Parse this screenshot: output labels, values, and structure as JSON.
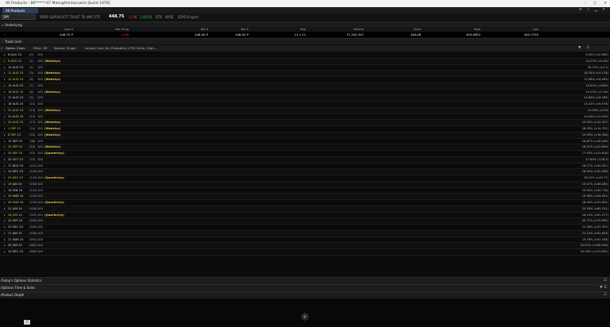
{
  "window": {
    "title": "All Products - 86******47 Main@thinkorswim [build 1978]",
    "controls": [
      "–",
      "□",
      "✕"
    ]
  },
  "tab": {
    "label": "All Products"
  },
  "toolbar_icons": [
    "gear-icon",
    "link-icon",
    "minimize-icon",
    "close-icon"
  ],
  "symbol": {
    "ticker": "SPY",
    "description": "SPDR S&P500 ETF TRUST TR UNIT ETF",
    "last": "448.75",
    "change": "-1.96",
    "bid_flag": "1.001%",
    "etb": "ETB",
    "nyse": "NYSE",
    "engine": "EDYO Engine"
  },
  "underlying": {
    "section_label": "Underlying",
    "headers": [
      "Last X",
      "Net Chng",
      "Bid X",
      "Ask X",
      "Size",
      "Volume",
      "Open",
      "High",
      "Low"
    ],
    "values": [
      "448.75 P",
      "-1.96",
      "448.00 P",
      "448.00 P",
      "11 x 11",
      "71,342,347",
      "448.08",
      "450.6952",
      "445.2705"
    ]
  },
  "trade_grid": {
    "label": "Trade Grid"
  },
  "option_chain": {
    "label": "Option Chain",
    "filter": "Filter: Off",
    "spread": "Spread: Single",
    "layout": "Layout: Impl Vol, Probability OTM, Delta, High,..."
  },
  "expirations": [
    {
      "date": "8 AUG 23",
      "dte": "(0)",
      "mult": "100",
      "tag": "",
      "iv": "5.55% (±0.695)"
    },
    {
      "date": "9 AUG 23",
      "dte": "(1)",
      "mult": "100",
      "tag": "(Weeklys)",
      "iv": "14.77% (±2.54)"
    },
    {
      "date": "10 AUG 23",
      "dte": "(2)",
      "mult": "100",
      "tag": "",
      "iv": "16.72% (±4.3)"
    },
    {
      "date": "11 AUG 23",
      "dte": "(3)",
      "mult": "100",
      "tag": "(Weeklys)",
      "iv": "16.33% (±5.178)"
    },
    {
      "date": "14 AUG 23",
      "dte": "(6)",
      "mult": "100",
      "tag": "(Weeklys)",
      "iv": "13.36% (±6.063)"
    },
    {
      "date": "15 AUG 23",
      "dte": "(7)",
      "mult": "100",
      "tag": "",
      "iv": "13.91% (±6.65)"
    },
    {
      "date": "16 AUG 23",
      "dte": "(8)",
      "mult": "100",
      "tag": "(Weeklys)",
      "iv": "14.23% (±7.49)"
    },
    {
      "date": "17 AUG 23",
      "dte": "(9)",
      "mult": "100",
      "tag": "",
      "iv": "14.64% (±8.185)"
    },
    {
      "date": "18 AUG 23",
      "dte": "(10)",
      "mult": "100",
      "tag": "",
      "iv": "15.43% (±8.978)"
    },
    {
      "date": "21 AUG 23",
      "dte": "(13)",
      "mult": "100",
      "tag": "(Weeklys)",
      "iv": "14.28% (±9.6)"
    },
    {
      "date": "22 AUG 23",
      "dte": "(14)",
      "mult": "100",
      "tag": "",
      "iv": "14.24% (±9.939)"
    },
    {
      "date": "25 AUG 23",
      "dte": "(17)",
      "mult": "100",
      "tag": "(Weeklys)",
      "iv": "15.93% (±12.257)"
    },
    {
      "date": "1 SEP 23",
      "dte": "(24)",
      "mult": "100",
      "tag": "(Weeklys)",
      "iv": "16.93% (±14.702)"
    },
    {
      "date": "8 SEP 23",
      "dte": "(31)",
      "mult": "100",
      "tag": "(Weeklys)",
      "iv": "15.99% (±16.356)"
    },
    {
      "date": "15 SEP 23",
      "dte": "(38)",
      "mult": "100",
      "tag": "",
      "iv": "16.87% (±18.456)"
    },
    {
      "date": "22 SEP 23",
      "dte": "(45)",
      "mult": "100",
      "tag": "(Weeklys)",
      "iv": "16.47% (±20.899)"
    },
    {
      "date": "29 SEP 23",
      "dte": "(52)",
      "mult": "100",
      "tag": "(Quarterlys)",
      "iv": "17.03% (±23.616)"
    },
    {
      "date": "20 OCT 23",
      "dte": "(73)",
      "mult": "100",
      "tag": "",
      "iv": "17.84% (±28.3)"
    },
    {
      "date": "17 NOV 23",
      "dte": "(101)",
      "mult": "100",
      "tag": "",
      "iv": "18.27% (±34.501)"
    },
    {
      "date": "15 DEC 23",
      "dte": "(129)",
      "mult": "100",
      "tag": "",
      "iv": "18.92% (±40.428)"
    },
    {
      "date": "29 DEC 23",
      "dte": "(143)",
      "mult": "100",
      "tag": "(Quarterlys)",
      "iv": "18.12% (±40.77)"
    },
    {
      "date": "19 JAN 24",
      "dte": "(164)",
      "mult": "100",
      "tag": "",
      "iv": "19.07% (±46.005)"
    },
    {
      "date": "16 FEB 24",
      "dte": "(192)",
      "mult": "100",
      "tag": "",
      "iv": "19.34% (±50.718)"
    },
    {
      "date": "15 MAR 24",
      "dte": "(220)",
      "mult": "100",
      "tag": "",
      "iv": "19.48% (±54.951)"
    },
    {
      "date": "28 MAR 24",
      "dte": "(233)",
      "mult": "100",
      "tag": "(Quarterlys)",
      "iv": "18.40% (±53.652)"
    },
    {
      "date": "21 JUN 24",
      "dte": "(318)",
      "mult": "100",
      "tag": "",
      "iv": "20.18% (±69.231)"
    },
    {
      "date": "28 JUN 24",
      "dte": "(325)",
      "mult": "100",
      "tag": "(Quarterlys)",
      "iv": "18.14% (±61.977)"
    },
    {
      "date": "20 SEP 24",
      "dte": "(409)",
      "mult": "100",
      "tag": "",
      "iv": "20.77% (±79.995)"
    },
    {
      "date": "20 DEC 24",
      "dte": "(500)",
      "mult": "100",
      "tag": "",
      "iv": "21.36% (±91.392)"
    },
    {
      "date": "17 JAN 25",
      "dte": "(528)",
      "mult": "100",
      "tag": "",
      "iv": "21.10% (±92.833)"
    },
    {
      "date": "21 MAR 25",
      "dte": "(591)",
      "mult": "100",
      "tag": "",
      "iv": "19.78% (±92.058)"
    },
    {
      "date": "20 JUN 25",
      "dte": "(682)",
      "mult": "100",
      "tag": "",
      "iv": "20.91% (±106.426)"
    },
    {
      "date": "19 DEC 25",
      "dte": "(864)",
      "mult": "100",
      "tag": "",
      "iv": "20.76% (±119.625)"
    }
  ],
  "sections": {
    "stats": "Today's Options Statistics",
    "time_sales": "Options Time & Sales",
    "depth": "Product Depth"
  }
}
